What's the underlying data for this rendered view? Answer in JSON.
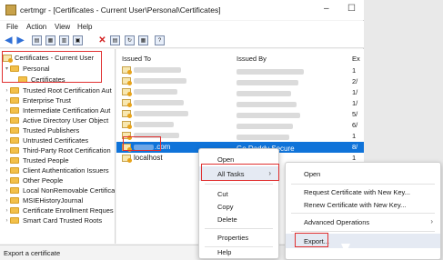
{
  "window": {
    "title": "certmgr - [Certificates - Current User\\Personal\\Certificates]",
    "minimize": "–",
    "maximize": "☐"
  },
  "menu": [
    "File",
    "Action",
    "View",
    "Help"
  ],
  "tree": {
    "root": "Certificates - Current User",
    "personal": "Personal",
    "certificates": "Certificates",
    "items": [
      "Trusted Root Certification Aut",
      "Enterprise Trust",
      "Intermediate Certification Aut",
      "Active Directory User Object",
      "Trusted Publishers",
      "Untrusted Certificates",
      "Third-Party Root Certification",
      "Trusted People",
      "Client Authentication Issuers",
      "Other People",
      "Local NonRemovable Certificat",
      "MSIEHistoryJournal",
      "Certificate Enrollment Reques",
      "Smart Card Trusted Roots"
    ]
  },
  "list": {
    "columns": [
      "Issued To",
      "Issued By",
      "Ex"
    ],
    "rows": [
      {
        "exp": "1"
      },
      {
        "exp": "2/"
      },
      {
        "exp": "1/"
      },
      {
        "exp": "1/"
      },
      {
        "exp": "5/"
      },
      {
        "exp": "6/"
      },
      {
        "exp": "1"
      },
      {
        "issued_to": ".com",
        "issued_by": "Go Daddy Secure",
        "exp": "8/"
      },
      {
        "issued_to": "localhost",
        "exp": "1"
      }
    ]
  },
  "context_menu": {
    "items": [
      "Open",
      "All Tasks",
      "Cut",
      "Copy",
      "Delete",
      "Properties",
      "Help"
    ]
  },
  "submenu": {
    "items": [
      "Open",
      "Request Certificate with New Key...",
      "Renew Certificate with New Key...",
      "Advanced Operations",
      "Export..."
    ]
  },
  "statusbar": "Export a certificate"
}
